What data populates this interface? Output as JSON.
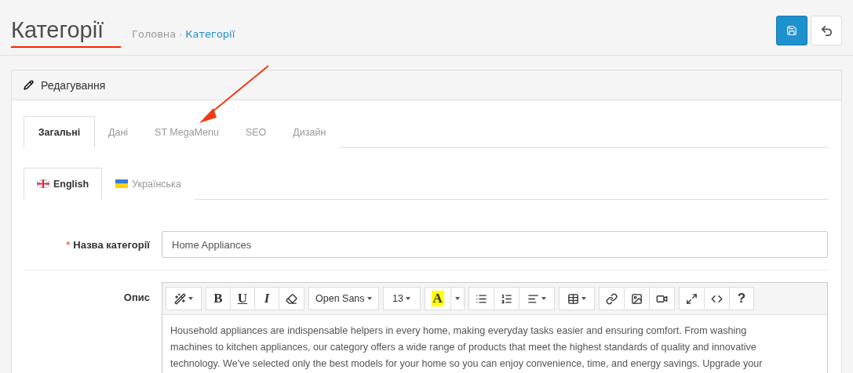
{
  "page": {
    "title": "Категорії",
    "separator": "›",
    "breadcrumb": [
      {
        "label": "Головна",
        "current": false
      },
      {
        "label": "Категорії",
        "current": true
      }
    ]
  },
  "header_buttons": [
    {
      "kind": "save"
    },
    {
      "kind": "back"
    }
  ],
  "panel": {
    "title": "Редагування"
  },
  "tabs": [
    {
      "label": "Загальні",
      "selected": true
    },
    {
      "label": "Дані",
      "selected": false
    },
    {
      "label": "ST MegaMenu",
      "selected": false
    },
    {
      "label": "SEO",
      "selected": false
    },
    {
      "label": "Дизайн",
      "selected": false
    }
  ],
  "language_tabs": [
    {
      "label": "English",
      "selected": true
    },
    {
      "label": "Українська",
      "selected": false
    }
  ],
  "name_field": {
    "required_mark": "*",
    "label": "Назва категорії",
    "value": "Home Appliances"
  },
  "description": {
    "label": "Опис",
    "toolbar": [
      [
        {
          "kind": "magic"
        }
      ],
      [
        {
          "kind": "bold",
          "text": "B"
        },
        {
          "kind": "underline",
          "text": "U"
        },
        {
          "kind": "italic",
          "text": "I"
        },
        {
          "kind": "eraser"
        }
      ],
      [
        {
          "kind": "dropdown",
          "text": "Open Sans"
        }
      ],
      [
        {
          "kind": "dropdown",
          "text": "13"
        }
      ],
      [
        {
          "kind": "color",
          "text": "A"
        },
        {
          "kind": "caret"
        }
      ],
      [
        {
          "kind": "list"
        },
        {
          "kind": "ordered"
        },
        {
          "kind": "align"
        }
      ],
      [
        {
          "kind": "table"
        }
      ],
      [
        {
          "kind": "link"
        },
        {
          "kind": "image"
        },
        {
          "kind": "video"
        }
      ],
      [
        {
          "kind": "fullscreen"
        },
        {
          "kind": "code"
        },
        {
          "kind": "help",
          "text": "?"
        }
      ]
    ],
    "lines": [
      "Household appliances are indispensable helpers in every home, making everyday tasks easier and ensuring comfort. From washing",
      "machines to kitchen appliances, our category offers a wide range of products that meet the highest standards of quality and innovative",
      "technology. We've selected only the best models for your home so you can enjoy convenience, time, and energy savings. Upgrade your"
    ]
  }
}
